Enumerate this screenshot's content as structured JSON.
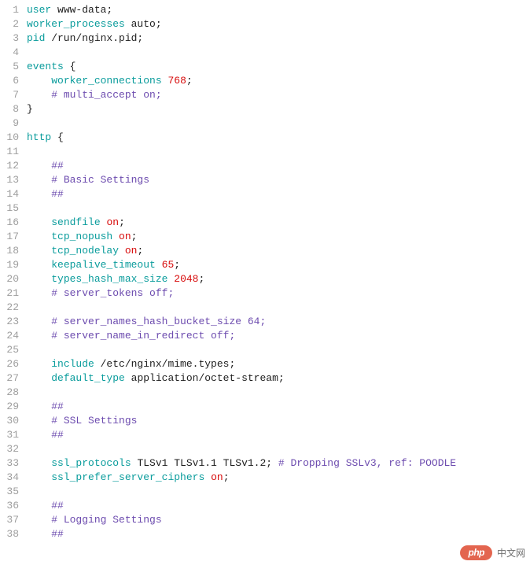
{
  "watermark": {
    "logo_main": "php",
    "logo_sub": "",
    "text": "中文网"
  },
  "code": [
    {
      "n": 1,
      "tokens": [
        {
          "c": "keyword",
          "t": "user"
        },
        {
          "c": "plain",
          "t": " www-data;"
        }
      ]
    },
    {
      "n": 2,
      "tokens": [
        {
          "c": "keyword",
          "t": "worker_processes"
        },
        {
          "c": "plain",
          "t": " auto;"
        }
      ]
    },
    {
      "n": 3,
      "tokens": [
        {
          "c": "keyword",
          "t": "pid"
        },
        {
          "c": "plain",
          "t": " /run/nginx.pid;"
        }
      ]
    },
    {
      "n": 4,
      "tokens": [
        {
          "c": "plain",
          "t": ""
        }
      ]
    },
    {
      "n": 5,
      "tokens": [
        {
          "c": "keyword",
          "t": "events"
        },
        {
          "c": "plain",
          "t": " {"
        }
      ]
    },
    {
      "n": 6,
      "tokens": [
        {
          "c": "plain",
          "t": "    "
        },
        {
          "c": "keyword",
          "t": "worker_connections"
        },
        {
          "c": "plain",
          "t": " "
        },
        {
          "c": "value",
          "t": "768"
        },
        {
          "c": "plain",
          "t": ";"
        }
      ]
    },
    {
      "n": 7,
      "tokens": [
        {
          "c": "plain",
          "t": "    "
        },
        {
          "c": "comment",
          "t": "# multi_accept on;"
        }
      ]
    },
    {
      "n": 8,
      "tokens": [
        {
          "c": "plain",
          "t": "}"
        }
      ]
    },
    {
      "n": 9,
      "tokens": [
        {
          "c": "plain",
          "t": ""
        }
      ]
    },
    {
      "n": 10,
      "tokens": [
        {
          "c": "keyword",
          "t": "http"
        },
        {
          "c": "plain",
          "t": " {"
        }
      ]
    },
    {
      "n": 11,
      "tokens": [
        {
          "c": "plain",
          "t": ""
        }
      ]
    },
    {
      "n": 12,
      "tokens": [
        {
          "c": "plain",
          "t": "    "
        },
        {
          "c": "comment",
          "t": "##"
        }
      ]
    },
    {
      "n": 13,
      "tokens": [
        {
          "c": "plain",
          "t": "    "
        },
        {
          "c": "comment",
          "t": "# Basic Settings"
        }
      ]
    },
    {
      "n": 14,
      "tokens": [
        {
          "c": "plain",
          "t": "    "
        },
        {
          "c": "comment",
          "t": "##"
        }
      ]
    },
    {
      "n": 15,
      "tokens": [
        {
          "c": "plain",
          "t": ""
        }
      ]
    },
    {
      "n": 16,
      "tokens": [
        {
          "c": "plain",
          "t": "    "
        },
        {
          "c": "keyword",
          "t": "sendfile"
        },
        {
          "c": "plain",
          "t": " "
        },
        {
          "c": "value",
          "t": "on"
        },
        {
          "c": "plain",
          "t": ";"
        }
      ]
    },
    {
      "n": 17,
      "tokens": [
        {
          "c": "plain",
          "t": "    "
        },
        {
          "c": "keyword",
          "t": "tcp_nopush"
        },
        {
          "c": "plain",
          "t": " "
        },
        {
          "c": "value",
          "t": "on"
        },
        {
          "c": "plain",
          "t": ";"
        }
      ]
    },
    {
      "n": 18,
      "tokens": [
        {
          "c": "plain",
          "t": "    "
        },
        {
          "c": "keyword",
          "t": "tcp_nodelay"
        },
        {
          "c": "plain",
          "t": " "
        },
        {
          "c": "value",
          "t": "on"
        },
        {
          "c": "plain",
          "t": ";"
        }
      ]
    },
    {
      "n": 19,
      "tokens": [
        {
          "c": "plain",
          "t": "    "
        },
        {
          "c": "keyword",
          "t": "keepalive_timeout"
        },
        {
          "c": "plain",
          "t": " "
        },
        {
          "c": "value",
          "t": "65"
        },
        {
          "c": "plain",
          "t": ";"
        }
      ]
    },
    {
      "n": 20,
      "tokens": [
        {
          "c": "plain",
          "t": "    "
        },
        {
          "c": "keyword",
          "t": "types_hash_max_size"
        },
        {
          "c": "plain",
          "t": " "
        },
        {
          "c": "value",
          "t": "2048"
        },
        {
          "c": "plain",
          "t": ";"
        }
      ]
    },
    {
      "n": 21,
      "tokens": [
        {
          "c": "plain",
          "t": "    "
        },
        {
          "c": "comment",
          "t": "# server_tokens off;"
        }
      ]
    },
    {
      "n": 22,
      "tokens": [
        {
          "c": "plain",
          "t": ""
        }
      ]
    },
    {
      "n": 23,
      "tokens": [
        {
          "c": "plain",
          "t": "    "
        },
        {
          "c": "comment",
          "t": "# server_names_hash_bucket_size 64;"
        }
      ]
    },
    {
      "n": 24,
      "tokens": [
        {
          "c": "plain",
          "t": "    "
        },
        {
          "c": "comment",
          "t": "# server_name_in_redirect off;"
        }
      ]
    },
    {
      "n": 25,
      "tokens": [
        {
          "c": "plain",
          "t": ""
        }
      ]
    },
    {
      "n": 26,
      "tokens": [
        {
          "c": "plain",
          "t": "    "
        },
        {
          "c": "keyword",
          "t": "include"
        },
        {
          "c": "plain",
          "t": " /etc/nginx/mime.types;"
        }
      ]
    },
    {
      "n": 27,
      "tokens": [
        {
          "c": "plain",
          "t": "    "
        },
        {
          "c": "keyword",
          "t": "default_type"
        },
        {
          "c": "plain",
          "t": " application/octet-stream;"
        }
      ]
    },
    {
      "n": 28,
      "tokens": [
        {
          "c": "plain",
          "t": ""
        }
      ]
    },
    {
      "n": 29,
      "tokens": [
        {
          "c": "plain",
          "t": "    "
        },
        {
          "c": "comment",
          "t": "##"
        }
      ]
    },
    {
      "n": 30,
      "tokens": [
        {
          "c": "plain",
          "t": "    "
        },
        {
          "c": "comment",
          "t": "# SSL Settings"
        }
      ]
    },
    {
      "n": 31,
      "tokens": [
        {
          "c": "plain",
          "t": "    "
        },
        {
          "c": "comment",
          "t": "##"
        }
      ]
    },
    {
      "n": 32,
      "tokens": [
        {
          "c": "plain",
          "t": ""
        }
      ]
    },
    {
      "n": 33,
      "tokens": [
        {
          "c": "plain",
          "t": "    "
        },
        {
          "c": "keyword",
          "t": "ssl_protocols"
        },
        {
          "c": "plain",
          "t": " TLSv1 TLSv1.1 TLSv1.2; "
        },
        {
          "c": "comment",
          "t": "# Dropping SSLv3, ref: POODLE"
        }
      ]
    },
    {
      "n": 34,
      "tokens": [
        {
          "c": "plain",
          "t": "    "
        },
        {
          "c": "keyword",
          "t": "ssl_prefer_server_ciphers"
        },
        {
          "c": "plain",
          "t": " "
        },
        {
          "c": "value",
          "t": "on"
        },
        {
          "c": "plain",
          "t": ";"
        }
      ]
    },
    {
      "n": 35,
      "tokens": [
        {
          "c": "plain",
          "t": ""
        }
      ]
    },
    {
      "n": 36,
      "tokens": [
        {
          "c": "plain",
          "t": "    "
        },
        {
          "c": "comment",
          "t": "##"
        }
      ]
    },
    {
      "n": 37,
      "tokens": [
        {
          "c": "plain",
          "t": "    "
        },
        {
          "c": "comment",
          "t": "# Logging Settings"
        }
      ]
    },
    {
      "n": 38,
      "tokens": [
        {
          "c": "plain",
          "t": "    "
        },
        {
          "c": "comment",
          "t": "##"
        }
      ]
    }
  ]
}
